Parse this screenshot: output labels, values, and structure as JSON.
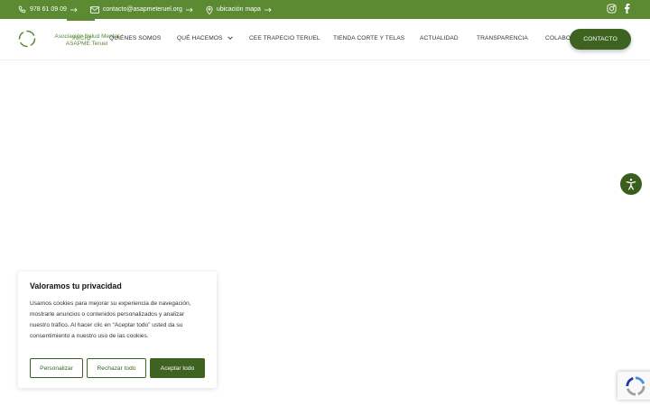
{
  "topbar": {
    "phone": "978 61 09 09",
    "email": "contacto@asapmeteruel.org",
    "location": "ubicación mapa",
    "social": [
      "instagram-icon",
      "facebook-icon"
    ]
  },
  "logo": {
    "line1": "Asociación Salud Mental",
    "line2": "ASAPME Teruel"
  },
  "nav": {
    "items": [
      {
        "label": "INICIO"
      },
      {
        "label": "QUIÉNES SOMOS"
      },
      {
        "label": "QUÉ HACEMOS"
      },
      {
        "label": "CEE TRAPECIO TERUEL"
      },
      {
        "label": "TIENDA CORTE Y TELAS"
      },
      {
        "label": "ACTUALIDAD"
      },
      {
        "label": "TRANSPARENCIA"
      },
      {
        "label": "COLABORA"
      }
    ],
    "contact": "CONTACTO"
  },
  "cookie": {
    "title": "Valoramos tu privacidad",
    "text": "Usamos cookies para mejorar su experiencia de navegación, mostrarle anuncios o contenidos personalizados y analizar nuestro tráfico. Al hacer clic en “Aceptar todo” usted da su consentimiento a nuestro uso de las cookies.",
    "customize": "Personalizar",
    "reject": "Rechazar todo",
    "accept": "Aceptar todo"
  },
  "colors": {
    "brand": "#5b8a32",
    "brand_dark": "#3e6321",
    "accessibility": "#3a5f1c"
  }
}
